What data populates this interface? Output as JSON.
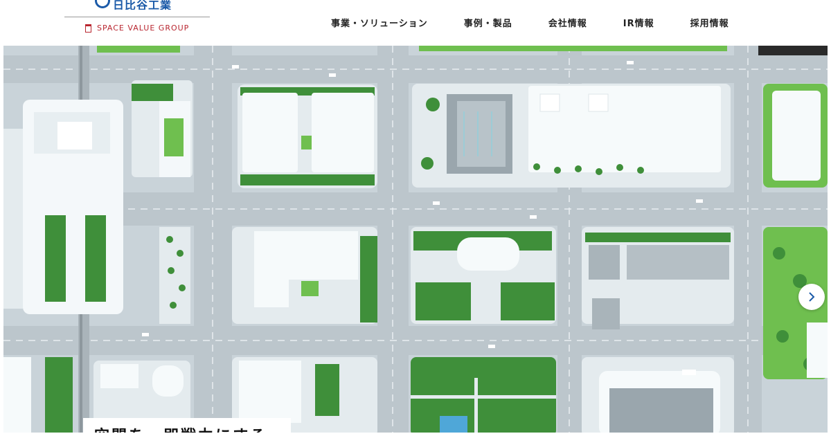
{
  "header": {
    "logo_text": "日比谷工業",
    "group_label": "SPACE VALUE GROUP"
  },
  "nav": {
    "items": [
      {
        "label": "事業・ソリューション"
      },
      {
        "label": "事例・製品"
      },
      {
        "label": "会社情報"
      },
      {
        "label": "IR情報"
      },
      {
        "label": "採用情報"
      }
    ]
  },
  "hero": {
    "image_alt": "",
    "caption": "空間を、即戦力にする。",
    "next_icon": "chevron-right-icon"
  },
  "colors": {
    "brand_blue": "#1b5aa8",
    "group_red": "#b8252f",
    "road": "#cdd6dc",
    "block": "#e4ebee",
    "building": "#f4f8fa",
    "tree": "#3f8f3a",
    "grass": "#6fbf4f"
  }
}
